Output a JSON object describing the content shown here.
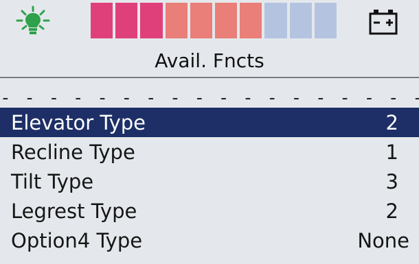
{
  "status": {
    "light_icon": "light-bulb-icon",
    "battery_icon": "battery-icon",
    "battery_segments": [
      {
        "color": "#e0407a",
        "state": "filled"
      },
      {
        "color": "#e0407a",
        "state": "filled"
      },
      {
        "color": "#e0407a",
        "state": "filled"
      },
      {
        "color": "#e97f78",
        "state": "filled"
      },
      {
        "color": "#e97f78",
        "state": "filled"
      },
      {
        "color": "#e97f78",
        "state": "filled"
      },
      {
        "color": "#e97f78",
        "state": "filled"
      },
      {
        "color": "#b4c4e0",
        "state": "empty"
      },
      {
        "color": "#b4c4e0",
        "state": "empty"
      },
      {
        "color": "#b4c4e0",
        "state": "empty"
      }
    ],
    "battery_level": 0.7
  },
  "title": "Avail. Fncts",
  "separator": "- - - - - - - - - - - - - - - - - -",
  "colors": {
    "selected_bg": "#1d2f66",
    "selected_fg": "#ffffff",
    "icon_green": "#2fa14a"
  },
  "menu": {
    "selected_index": 0,
    "items": [
      {
        "label": "Elevator Type",
        "value": "2"
      },
      {
        "label": "Recline Type",
        "value": "1"
      },
      {
        "label": "Tilt Type",
        "value": "3"
      },
      {
        "label": "Legrest Type",
        "value": "2"
      },
      {
        "label": "Option4 Type",
        "value": "None"
      }
    ]
  }
}
